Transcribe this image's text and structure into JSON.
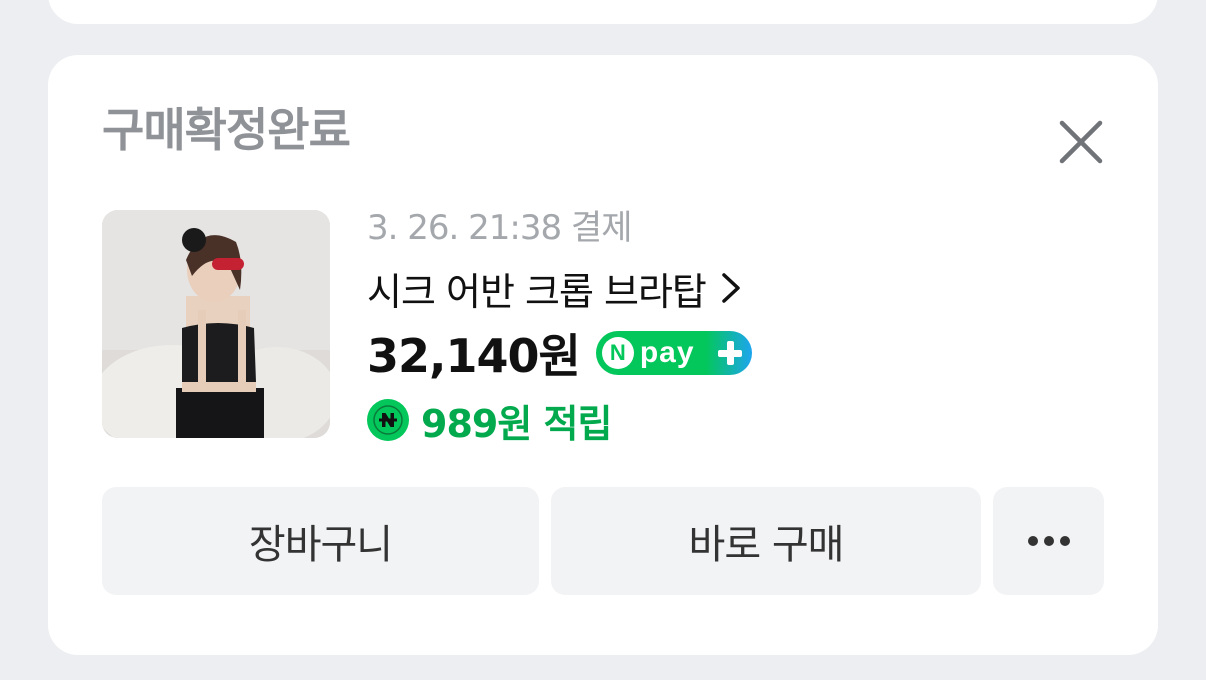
{
  "order_card": {
    "status_title": "구매확정완료",
    "close_icon": "close-icon",
    "product_image": "product-thumbnail",
    "paid_date": "3. 26. 21:38 결제",
    "product_name": "시크 어반 크롭 브라탑",
    "price": "32,140원",
    "npay_badge": {
      "n": "N",
      "text": "pay",
      "plus": "+"
    },
    "reward": {
      "icon": "naver-point-icon",
      "text": "989원 적립"
    },
    "buttons": {
      "cart_label": "장바구니",
      "buy_label": "바로 구매",
      "more_icon": "more-icon"
    }
  },
  "colors": {
    "background": "#eceef1",
    "card": "#ffffff",
    "accent_green": "#03c75a",
    "reward_text": "#03a94d",
    "npay_blue": "#1ea5ee",
    "title_gray": "#8f9296",
    "button_bg": "#f2f3f5"
  }
}
